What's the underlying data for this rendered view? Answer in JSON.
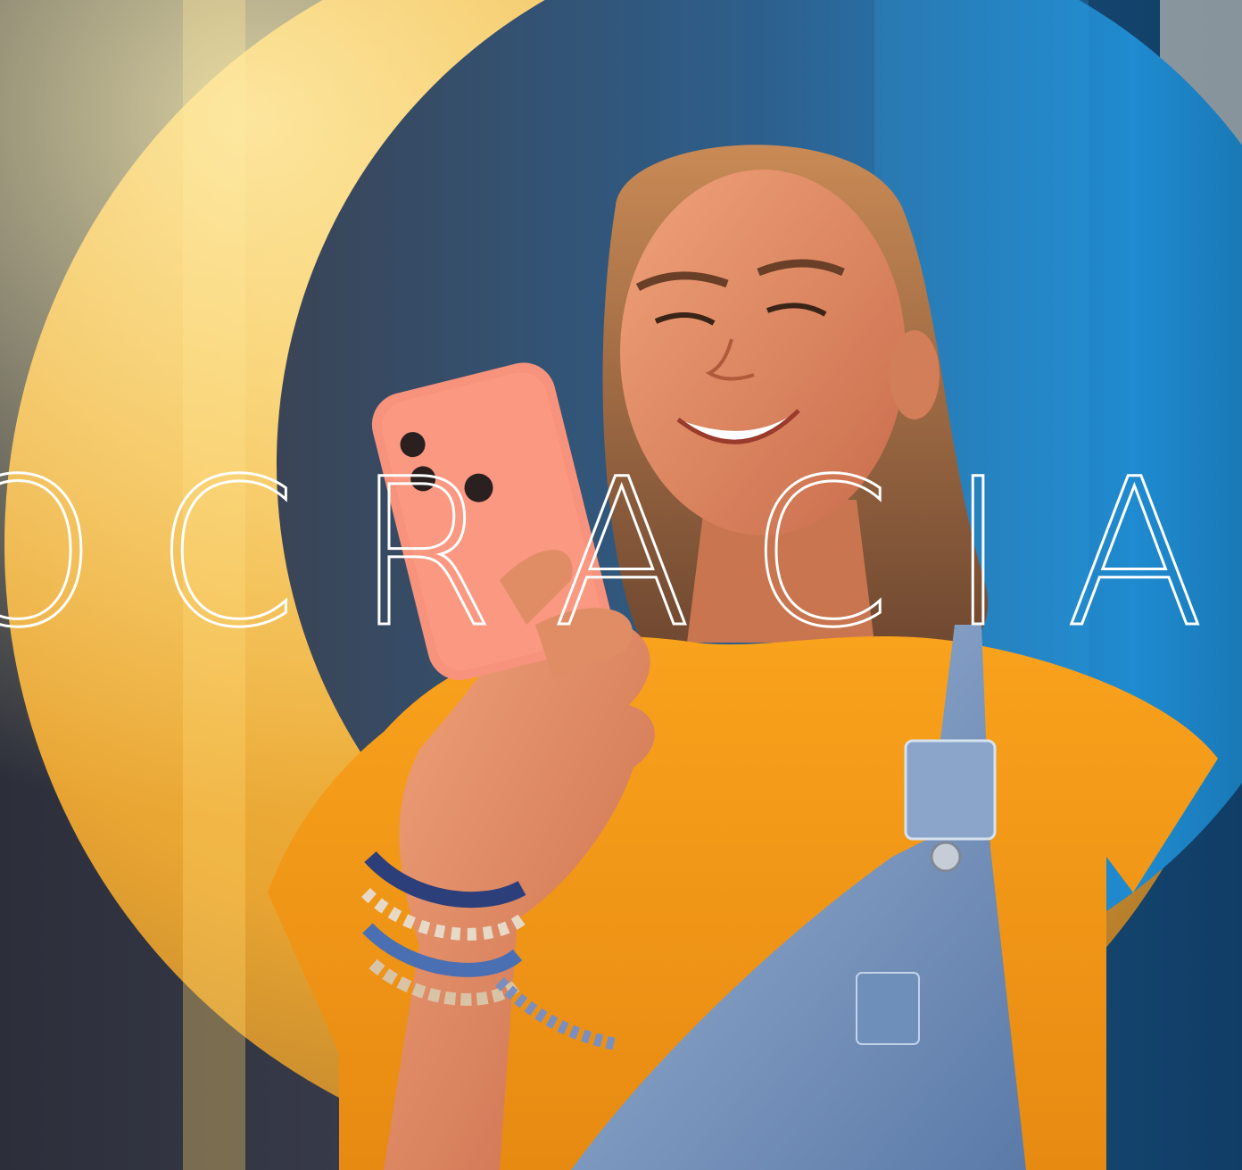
{
  "headline": {
    "text": "OCRACIA",
    "letters": [
      "O",
      "C",
      "R",
      "A",
      "C",
      "I",
      "A"
    ],
    "color": "#ffffff"
  },
  "colors": {
    "yellow_ring": "#f3b12a",
    "blue_backdrop": "#1e86c8",
    "shirt": "#f7a21f",
    "phone_case": "#f7927c",
    "denim": "#7c98bf",
    "skin": "#e7966d",
    "hair": "#8a5a3b"
  }
}
